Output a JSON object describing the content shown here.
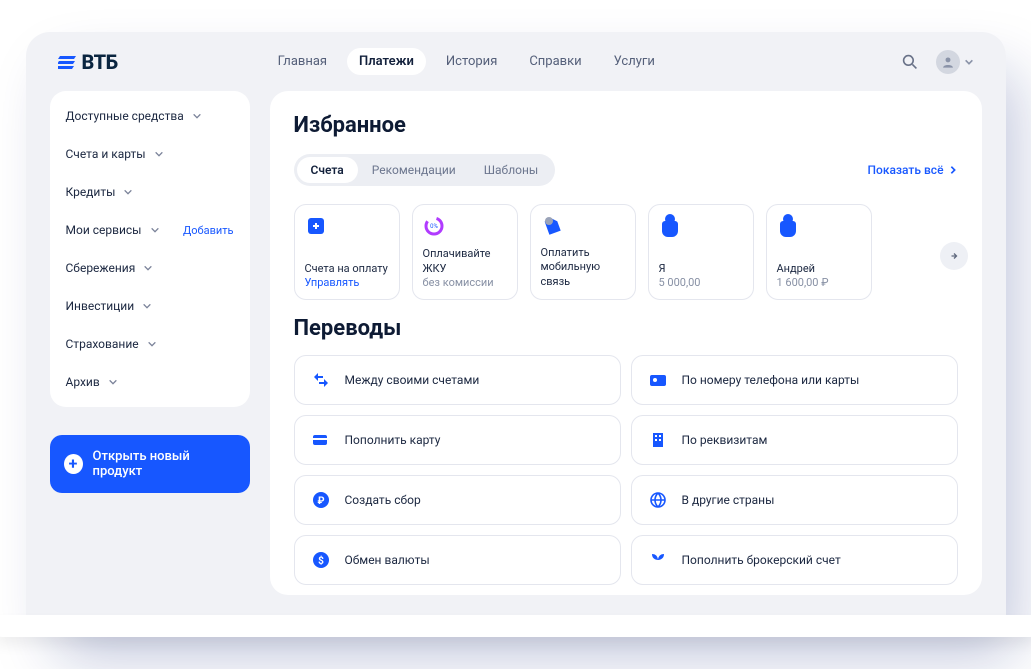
{
  "header": {
    "logo_text": "ВТБ",
    "nav": {
      "home": "Главная",
      "payments": "Платежи",
      "history": "История",
      "refs": "Справки",
      "services": "Услуги"
    }
  },
  "sidebar": {
    "items": [
      {
        "label": "Доступные средства"
      },
      {
        "label": "Счета и карты"
      },
      {
        "label": "Кредиты"
      },
      {
        "label": "Мои сервисы",
        "action": "Добавить"
      },
      {
        "label": "Сбережения"
      },
      {
        "label": "Инвестиции"
      },
      {
        "label": "Страхование"
      },
      {
        "label": "Архив"
      }
    ],
    "new_product": "Открыть новый продукт"
  },
  "favorites": {
    "title": "Избранное",
    "tabs": {
      "accounts": "Счета",
      "recommend": "Рекомендации",
      "templates": "Шаблоны"
    },
    "show_all": "Показать всё",
    "cards": [
      {
        "title": "Счета на оплату",
        "sub": "Управлять",
        "sub_blue": true
      },
      {
        "title": "Оплачивайте ЖКУ",
        "sub": "без комиссии"
      },
      {
        "title": "Оплатить мобильную связь",
        "sub": ""
      },
      {
        "title": "Я",
        "sub": "5 000,00"
      },
      {
        "title": "Андрей",
        "sub": "1 600,00 ₽"
      }
    ]
  },
  "transfers": {
    "title": "Переводы",
    "items": [
      {
        "label": "Между своими счетами"
      },
      {
        "label": "По номеру телефона или карты"
      },
      {
        "label": "Пополнить карту"
      },
      {
        "label": "По реквизитам"
      },
      {
        "label": "Создать сбор"
      },
      {
        "label": "В другие страны"
      },
      {
        "label": "Обмен валюты"
      },
      {
        "label": "Пополнить брокерский счет"
      }
    ]
  }
}
